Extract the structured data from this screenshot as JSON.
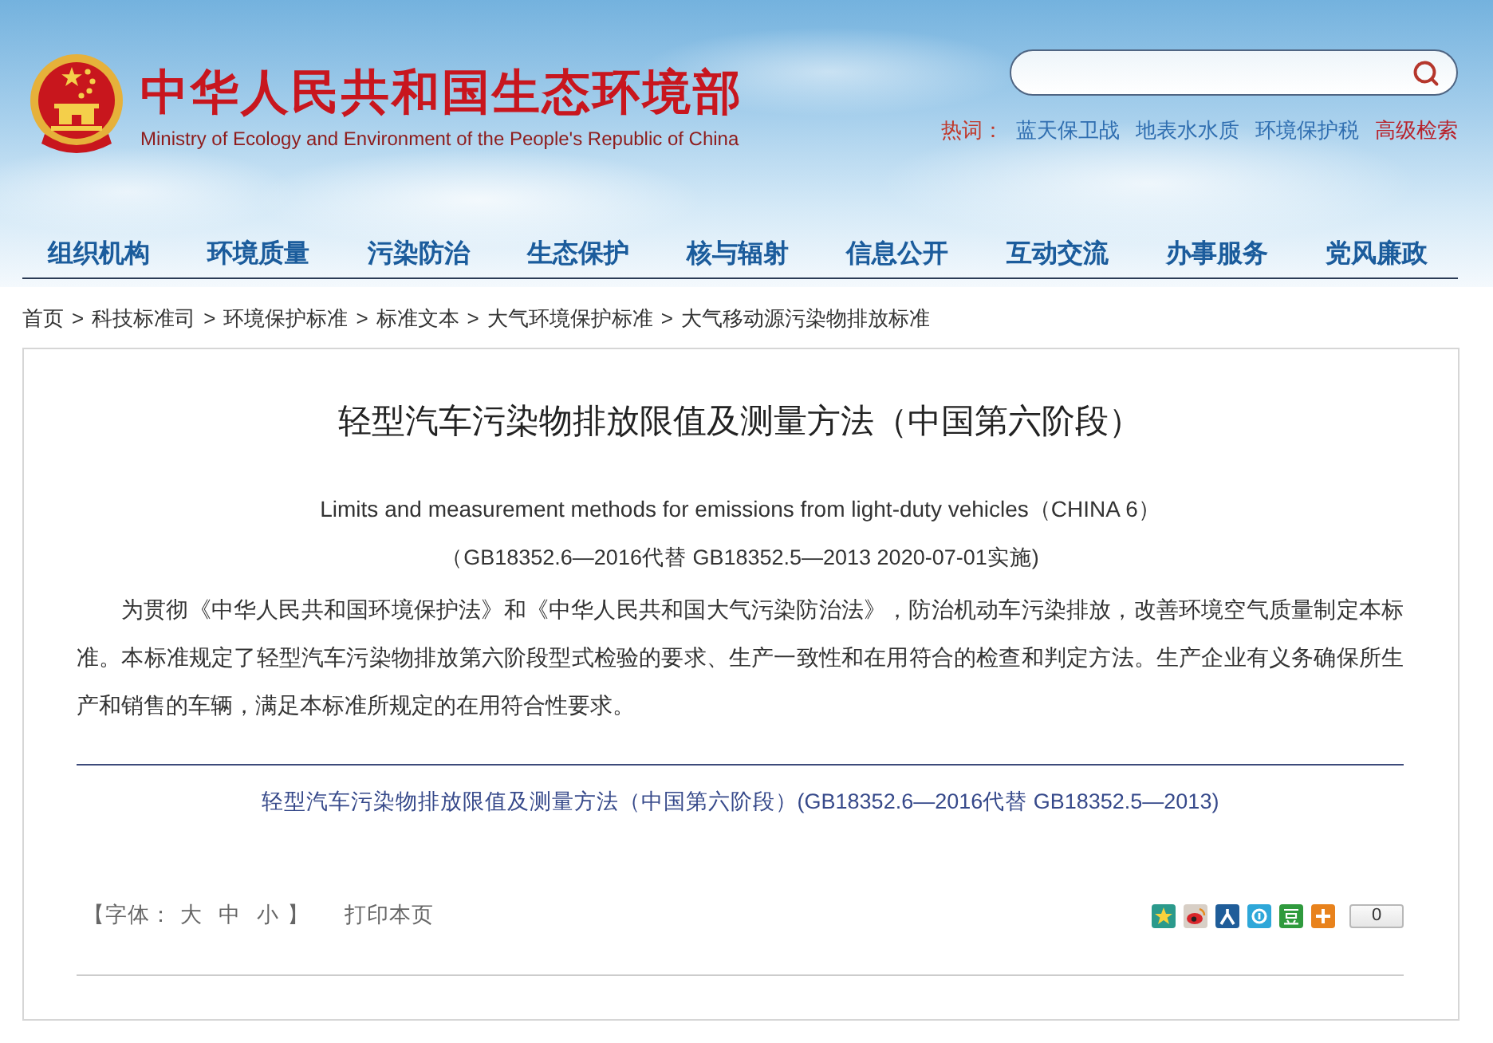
{
  "header": {
    "title": "中华人民共和国生态环境部",
    "subtitle": "Ministry of Ecology and Environment of the People's Republic of China",
    "hot_words": {
      "label": "热词：",
      "items": [
        "蓝天保卫战",
        "地表水水质",
        "环境保护税"
      ]
    },
    "advanced_search": "高级检索"
  },
  "nav": [
    "组织机构",
    "环境质量",
    "污染防治",
    "生态保护",
    "核与辐射",
    "信息公开",
    "互动交流",
    "办事服务",
    "党风廉政"
  ],
  "breadcrumb": [
    {
      "label": "首页"
    },
    {
      "separator": ">",
      "label": "科技标准司"
    },
    {
      "separator": ">",
      "label": "环境保护标准"
    },
    {
      "separator": ">",
      "label": "标准文本"
    },
    {
      "separator": ">",
      "label": "大气环境保护标准"
    },
    {
      "separator": ">",
      "label": "大气移动源污染物排放标准"
    }
  ],
  "article": {
    "title": "轻型汽车污染物排放限值及测量方法（中国第六阶段）",
    "english_title": "Limits and measurement methods for emissions from light-duty vehicles（CHINA 6）",
    "standard_info": "（GB18352.6—2016代替 GB18352.5—2013 2020-07-01实施)",
    "paragraph": "为贯彻《中华人民共和国环境保护法》和《中华人民共和国大气污染防治法》，防治机动车污染排放，改善环境空气质量制定本标准。本标准规定了轻型汽车污染物排放第六阶段型式检验的要求、生产一致性和在用符合的检查和判定方法。生产企业有义务确保所生产和销售的车辆，满足本标准所规定的在用符合性要求。",
    "link": "轻型汽车污染物排放限值及测量方法（中国第六阶段）(GB18352.6—2016代替 GB18352.5—2013)"
  },
  "tools": {
    "font_size": {
      "open": "【字体：",
      "options": [
        "大",
        "中",
        "小"
      ],
      "close": "】"
    },
    "print": "打印本页",
    "share_count": "0"
  }
}
